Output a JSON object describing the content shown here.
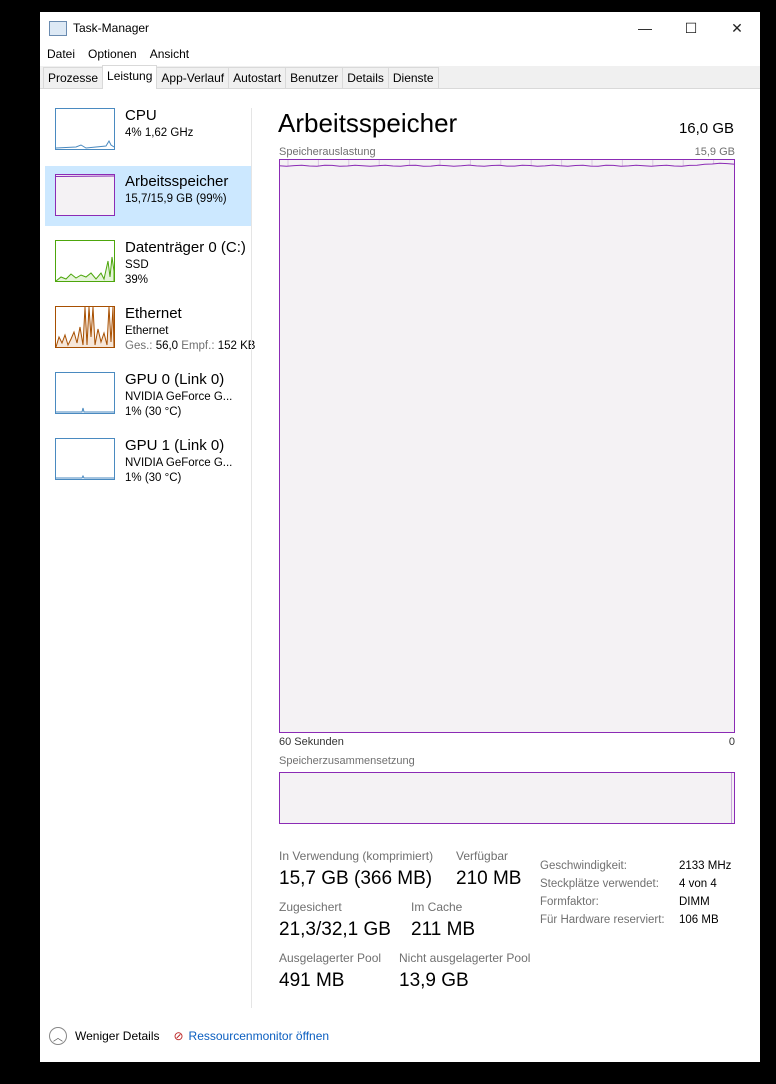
{
  "window": {
    "title": "Task-Manager",
    "min": "—",
    "max": "☐",
    "close": "✕"
  },
  "menu": [
    "Datei",
    "Optionen",
    "Ansicht"
  ],
  "tabs": [
    "Prozesse",
    "Leistung",
    "App-Verlauf",
    "Autostart",
    "Benutzer",
    "Details",
    "Dienste"
  ],
  "sidebar": [
    {
      "title": "CPU",
      "sub": "4% 1,62 GHz",
      "color": "#4a8ac0"
    },
    {
      "title": "Arbeitsspeicher",
      "sub": "15,7/15,9 GB (99%)",
      "color": "#8b2bb5"
    },
    {
      "title": "Datenträger 0 (C:)",
      "sub": "SSD",
      "sub2": "39%",
      "color": "#4da60c"
    },
    {
      "title": "Ethernet",
      "sub": "Ethernet",
      "sub2_label1": "Ges.:",
      "sub2_val1": "56,0",
      "sub2_label2": "Empf.:",
      "sub2_val2": "152 KB",
      "color": "#a74f01"
    },
    {
      "title": "GPU 0 (Link 0)",
      "sub": "NVIDIA GeForce G...",
      "sub2": "1%  (30 °C)",
      "color": "#4a8ac0"
    },
    {
      "title": "GPU 1 (Link 0)",
      "sub": "NVIDIA GeForce G...",
      "sub2": "1%  (30 °C)",
      "color": "#4a8ac0"
    }
  ],
  "main": {
    "title": "Arbeitsspeicher",
    "total": "16,0 GB",
    "graph_label": "Speicherauslastung",
    "graph_max": "15,9 GB",
    "x_left": "60 Sekunden",
    "x_right": "0",
    "usage_percent": 99,
    "composition_label": "Speicherzusammensetzung",
    "stats": {
      "in_use_label": "In Verwendung (komprimiert)",
      "in_use": "15,7 GB (366 MB)",
      "available_label": "Verfügbar",
      "available": "210 MB",
      "committed_label": "Zugesichert",
      "committed": "21,3/32,1 GB",
      "cached_label": "Im Cache",
      "cached": "211 MB",
      "paged_label": "Ausgelagerter Pool",
      "paged": "491 MB",
      "nonpaged_label": "Nicht ausgelagerter Pool",
      "nonpaged": "13,9 GB"
    },
    "specs": [
      {
        "k": "Geschwindigkeit:",
        "v": "2133 MHz"
      },
      {
        "k": "Steckplätze verwendet:",
        "v": "4 von 4"
      },
      {
        "k": "Formfaktor:",
        "v": "DIMM"
      },
      {
        "k": "Für Hardware reserviert:",
        "v": "106 MB"
      }
    ]
  },
  "footer": {
    "less": "Weniger Details",
    "monitor": "Ressourcenmonitor öffnen"
  }
}
